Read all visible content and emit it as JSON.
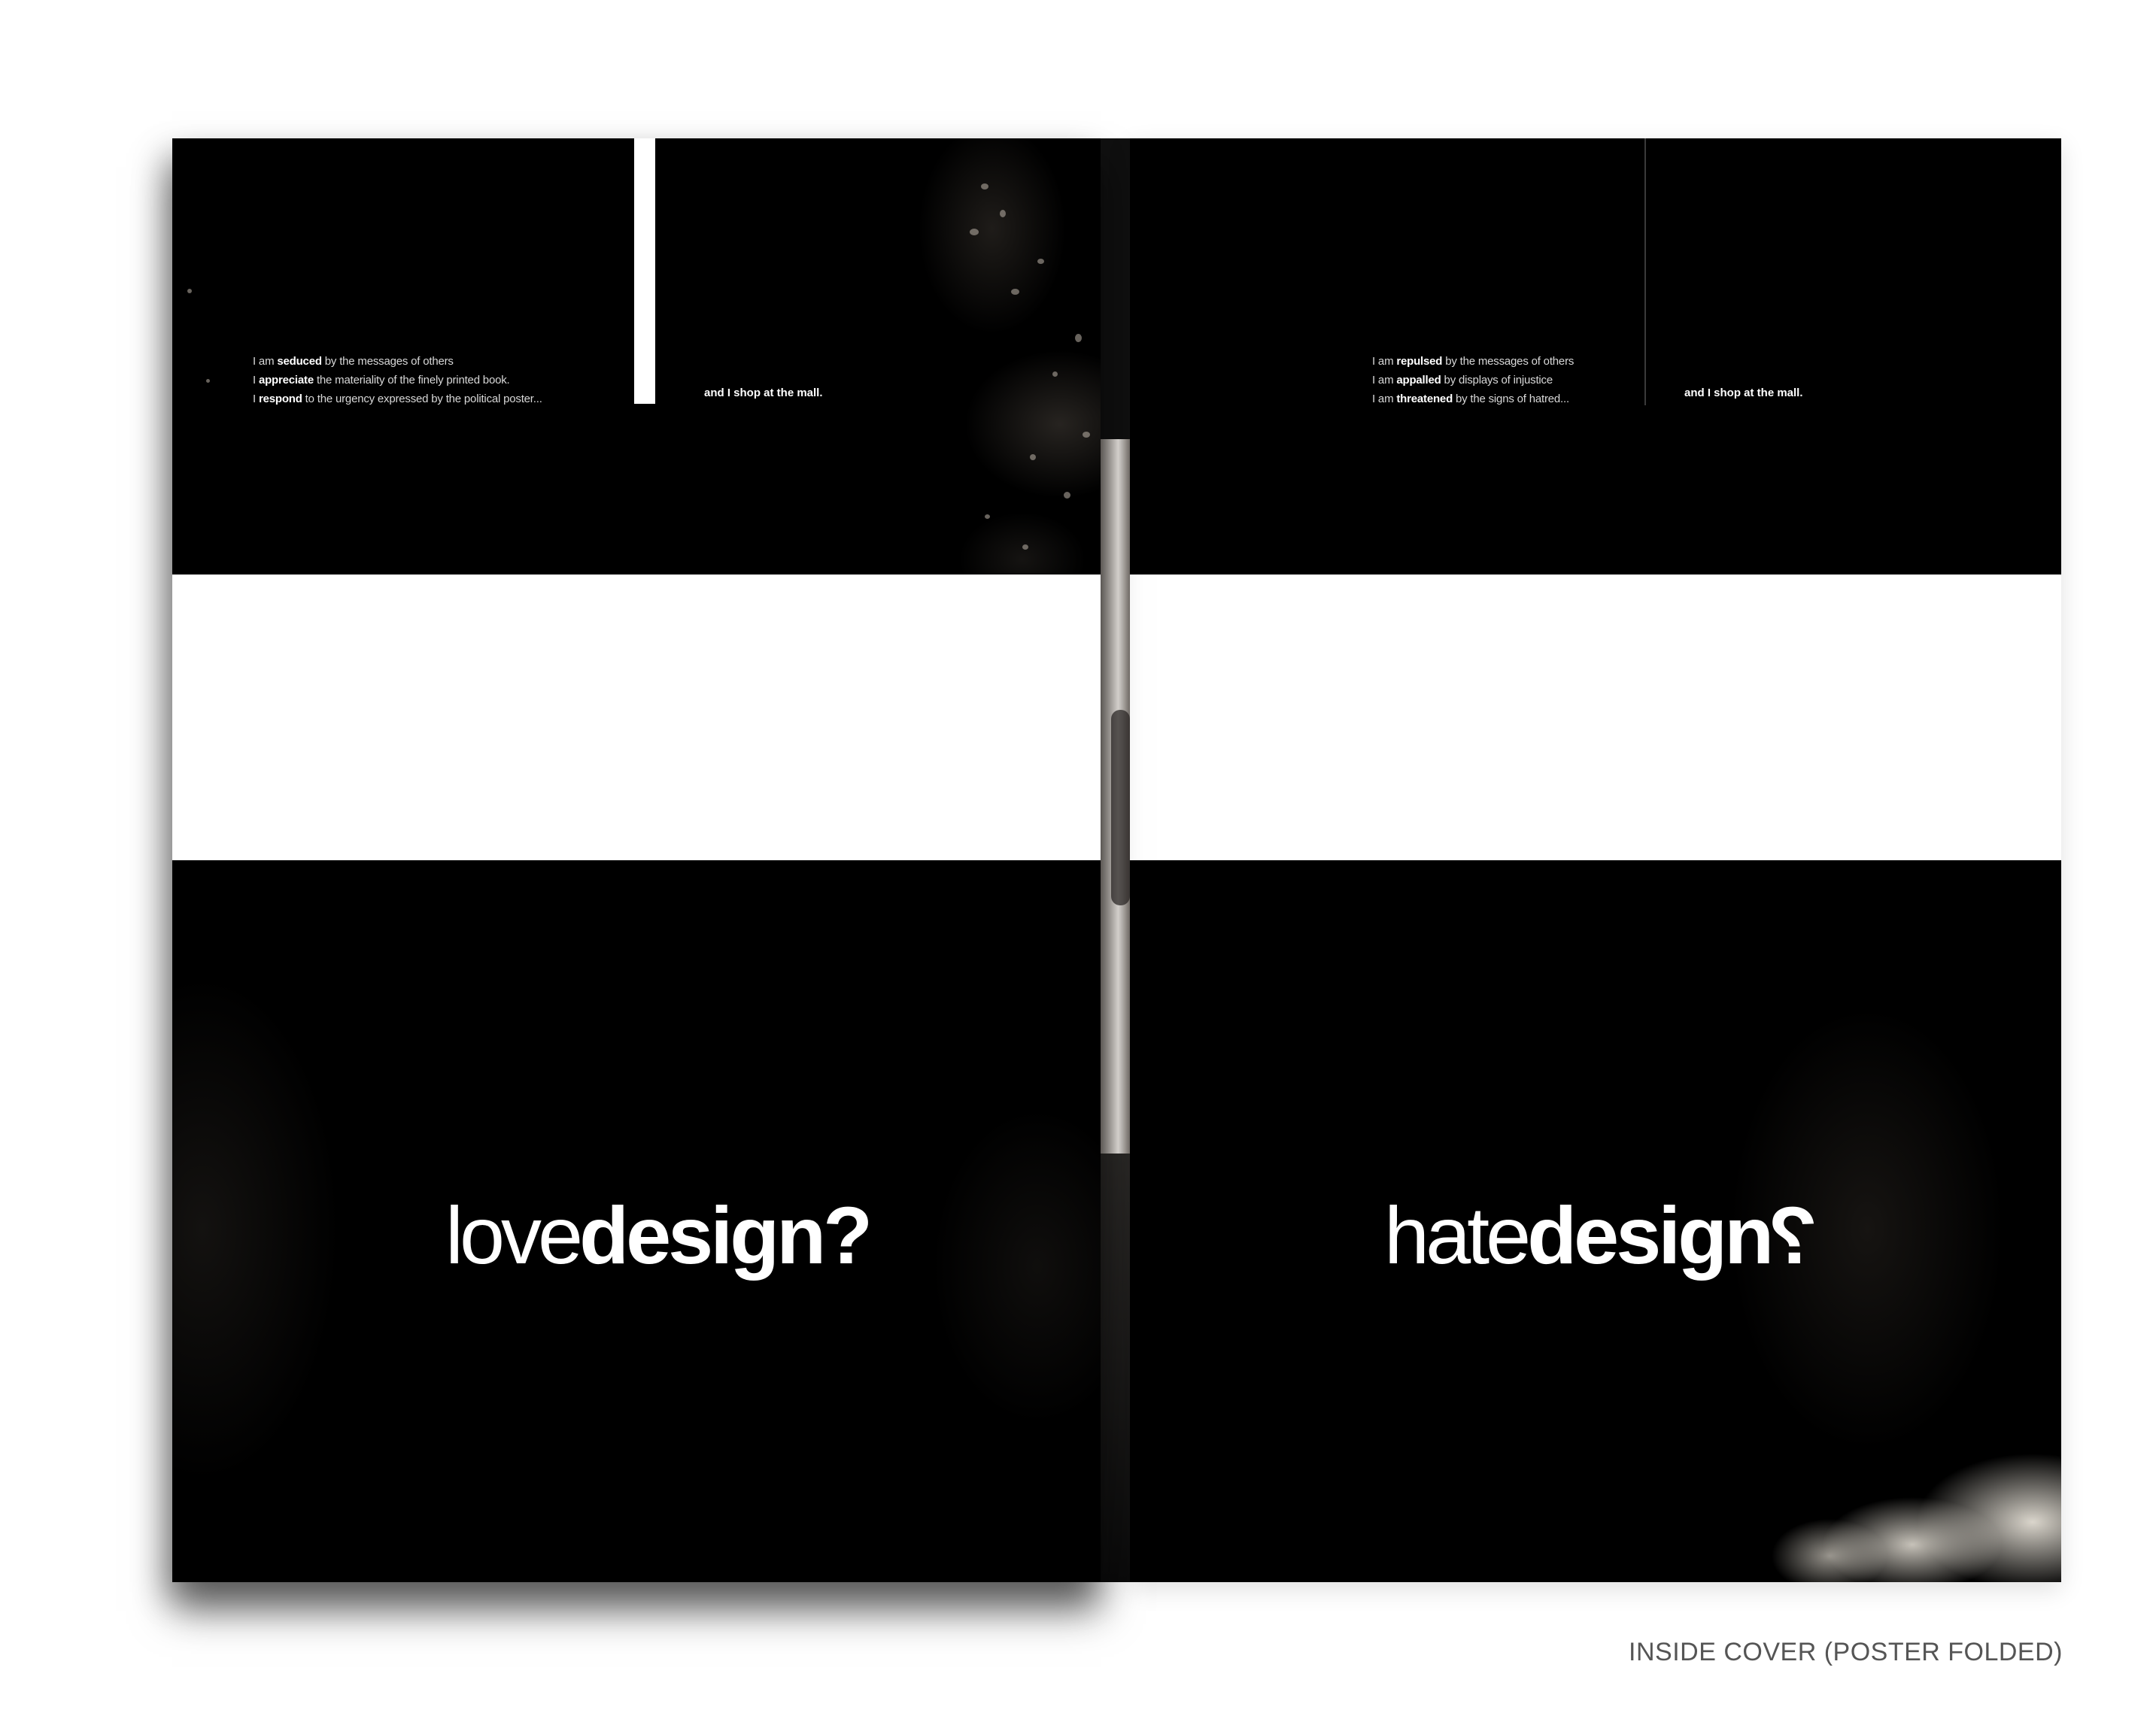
{
  "left_page": {
    "lines": [
      {
        "pre": "I am ",
        "bold": "seduced",
        "post": " by the messages of others"
      },
      {
        "pre": "I ",
        "bold": "appreciate",
        "post": " the materiality of the finely printed book."
      },
      {
        "pre": "I ",
        "bold": "respond",
        "post": " to the urgency expressed by the political poster..."
      }
    ],
    "tagline": "and I shop at the mall.",
    "headline_light": "love",
    "headline_bold": "design",
    "headline_mark": "?"
  },
  "right_page": {
    "lines": [
      {
        "pre": "I am ",
        "bold": "repulsed",
        "post": " by the messages of others"
      },
      {
        "pre": "I am ",
        "bold": "appalled",
        "post": " by displays of injustice"
      },
      {
        "pre": "I am ",
        "bold": "threatened",
        "post": " by the signs of hatred..."
      }
    ],
    "tagline": "and I shop at the mall.",
    "headline_light": "hate",
    "headline_bold": "design",
    "headline_mark": "?"
  },
  "caption": "INSIDE COVER (POSTER FOLDED)"
}
